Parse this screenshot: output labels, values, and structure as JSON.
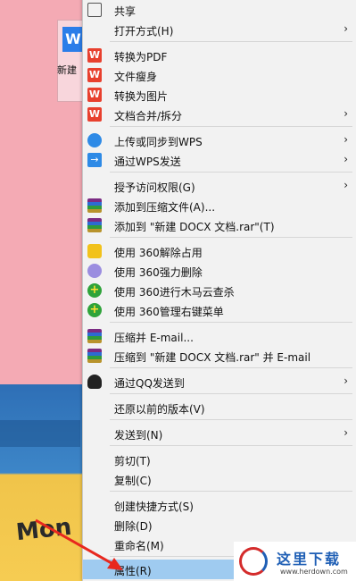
{
  "desktop": {
    "icon_label": "新建",
    "background_word": "Mon"
  },
  "menu": {
    "items": [
      {
        "label": "共享",
        "icon": "share-icon",
        "top": 0
      },
      {
        "label": "打开方式(H)",
        "submenu": true
      },
      {
        "label": "转换为PDF",
        "icon": "wps-icon"
      },
      {
        "label": "文件瘦身",
        "icon": "wps-icon"
      },
      {
        "label": "转换为图片",
        "icon": "wps-icon"
      },
      {
        "label": "文档合并/拆分",
        "icon": "wps-icon",
        "submenu": true
      },
      {
        "label": "上传或同步到WPS",
        "icon": "cloud-upload-icon",
        "submenu": true
      },
      {
        "label": "通过WPS发送",
        "icon": "send-icon",
        "submenu": true
      },
      {
        "label": "授予访问权限(G)",
        "submenu": true
      },
      {
        "label": "添加到压缩文件(A)...",
        "icon": "winrar-icon"
      },
      {
        "label": "添加到 \"新建 DOCX 文档.rar\"(T)",
        "icon": "winrar-icon"
      },
      {
        "label": "使用 360解除占用",
        "icon": "360-unlock-icon"
      },
      {
        "label": "使用 360强力删除",
        "icon": "360-delete-icon"
      },
      {
        "label": "使用 360进行木马云查杀",
        "icon": "360-scan-icon"
      },
      {
        "label": "使用 360管理右键菜单",
        "icon": "360-menu-icon"
      },
      {
        "label": "压缩并 E-mail...",
        "icon": "winrar-icon"
      },
      {
        "label": "压缩到 \"新建 DOCX 文档.rar\" 并 E-mail",
        "icon": "winrar-icon"
      },
      {
        "label": "通过QQ发送到",
        "icon": "qq-icon",
        "submenu": true
      },
      {
        "label": "还原以前的版本(V)"
      },
      {
        "label": "发送到(N)",
        "submenu": true
      },
      {
        "label": "剪切(T)"
      },
      {
        "label": "复制(C)"
      },
      {
        "label": "创建快捷方式(S)"
      },
      {
        "label": "删除(D)"
      },
      {
        "label": "重命名(M)"
      },
      {
        "label": "属性(R)",
        "highlighted": true
      }
    ],
    "submenu_arrow": "›"
  },
  "watermark": {
    "title": "这里下载",
    "url": "www.herdown.com"
  },
  "colors": {
    "menu_bg": "#f2f2f2",
    "highlight": "#9fcbf0",
    "arrow": "#e8281e"
  }
}
